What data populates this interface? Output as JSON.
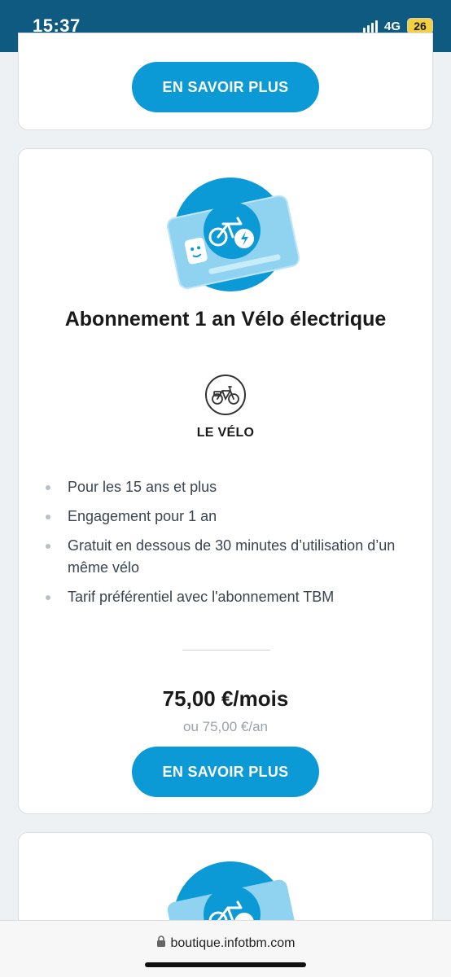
{
  "status_bar": {
    "time": "15:37",
    "network": "4G",
    "battery": "26"
  },
  "cards": {
    "top": {
      "button_label": "EN SAVOIR PLUS"
    },
    "main": {
      "title": "Abonnement 1 an Vélo électrique",
      "category_label": "LE VÉLO",
      "features": [
        "Pour les 15 ans et plus",
        "Engagement pour 1 an",
        "Gratuit en dessous de 30 minutes d’utilisation d’un même vélo",
        "Tarif préférentiel avec l'abonnement TBM"
      ],
      "price": "75,00 €/mois",
      "price_alt": "ou 75,00 €/an",
      "button_label": "EN SAVOIR PLUS"
    }
  },
  "browser": {
    "url": "boutique.infotbm.com"
  },
  "colors": {
    "status_bar": "#0e5a80",
    "accent": "#0c9ad6",
    "card_light": "#8fd3f0"
  },
  "icons": {
    "hero": "bike-card-icon",
    "category": "bike-icon",
    "lock": "lock-icon"
  }
}
